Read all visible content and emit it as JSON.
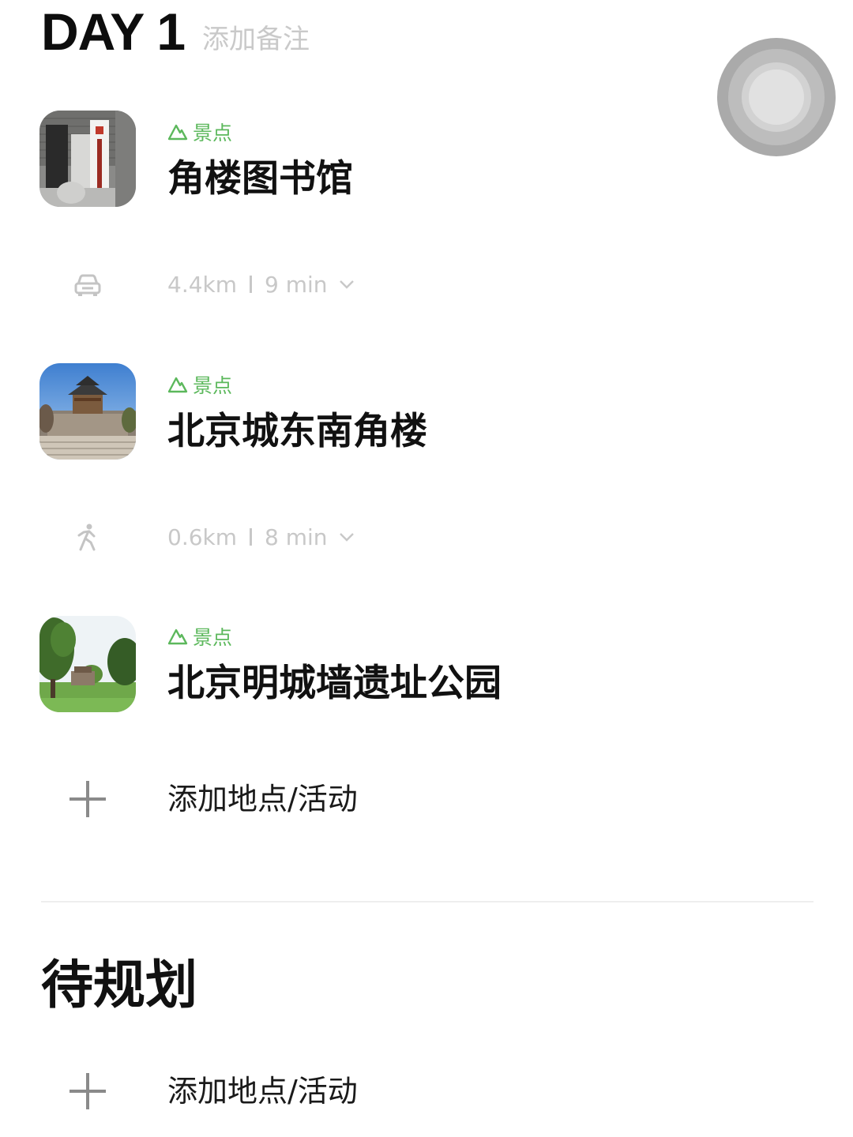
{
  "header": {
    "day_label": "DAY 1",
    "add_note": "添加备注"
  },
  "places": [
    {
      "tag": "景点",
      "name": "角楼图书馆",
      "thumbnail": "library-gate-photo"
    },
    {
      "tag": "景点",
      "name": "北京城东南角楼",
      "thumbnail": "corner-tower-photo"
    },
    {
      "tag": "景点",
      "name": "北京明城墙遗址公园",
      "thumbnail": "park-trees-photo"
    }
  ],
  "routes": [
    {
      "mode": "car-icon",
      "distance": "4.4km",
      "duration": "9 min"
    },
    {
      "mode": "walking-icon",
      "distance": "0.6km",
      "duration": "8 min"
    }
  ],
  "day_add": {
    "label": "添加地点/活动"
  },
  "pending": {
    "title": "待规划",
    "add_label": "添加地点/活动"
  },
  "colors": {
    "tag_green": "#5cb85c",
    "muted_gray": "#c8c8c8",
    "text": "#111111"
  }
}
